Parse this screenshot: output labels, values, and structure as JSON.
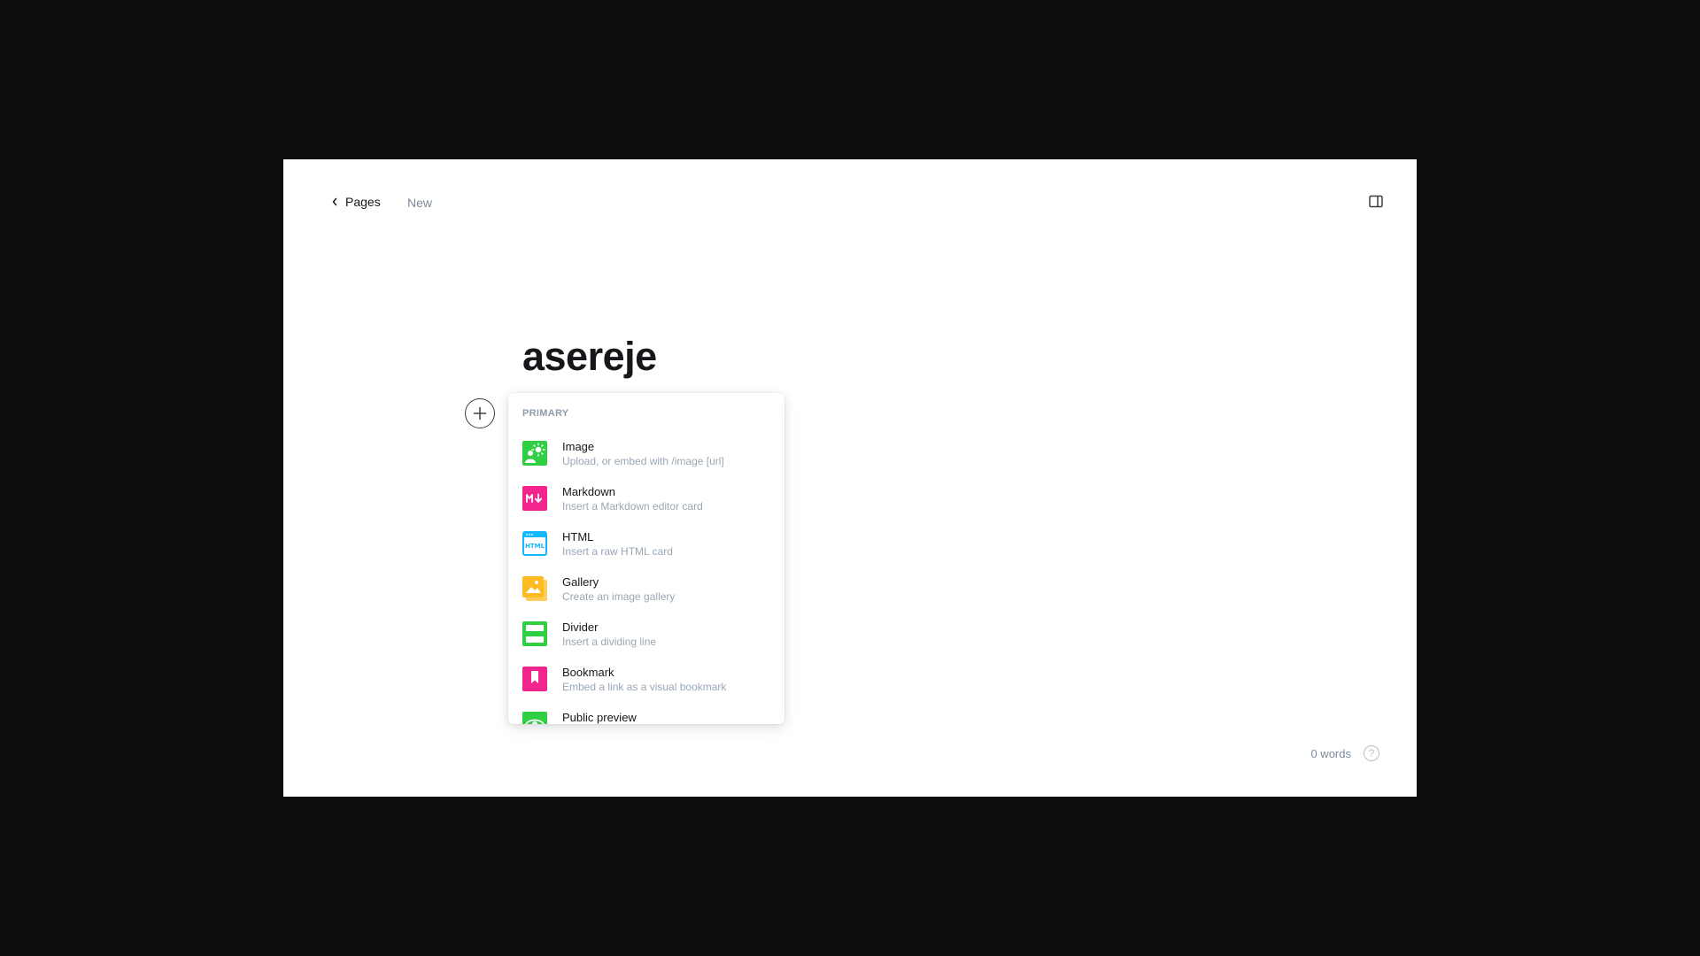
{
  "topbar": {
    "back_label": "Pages",
    "status": "New"
  },
  "editor": {
    "title": "asereje"
  },
  "card_menu": {
    "section_label": "PRIMARY",
    "items": [
      {
        "label": "Image",
        "desc": "Upload, or embed with /image [url]",
        "icon": "image-icon",
        "color": "#30cf43"
      },
      {
        "label": "Markdown",
        "desc": "Insert a Markdown editor card",
        "icon": "markdown-icon",
        "color": "#f2248d"
      },
      {
        "label": "HTML",
        "desc": "Insert a raw HTML card",
        "icon": "html-icon",
        "color": "#14b8ff"
      },
      {
        "label": "Gallery",
        "desc": "Create an image gallery",
        "icon": "gallery-icon",
        "color": "#fdbb23"
      },
      {
        "label": "Divider",
        "desc": "Insert a dividing line",
        "icon": "divider-icon",
        "color": "#30cf43"
      },
      {
        "label": "Bookmark",
        "desc": "Embed a link as a visual bookmark",
        "icon": "bookmark-icon",
        "color": "#f2248d"
      },
      {
        "label": "Public preview",
        "desc": "",
        "icon": "eye-icon",
        "color": "#30cf43"
      }
    ]
  },
  "footer": {
    "word_count": "0 words",
    "help_symbol": "?"
  }
}
